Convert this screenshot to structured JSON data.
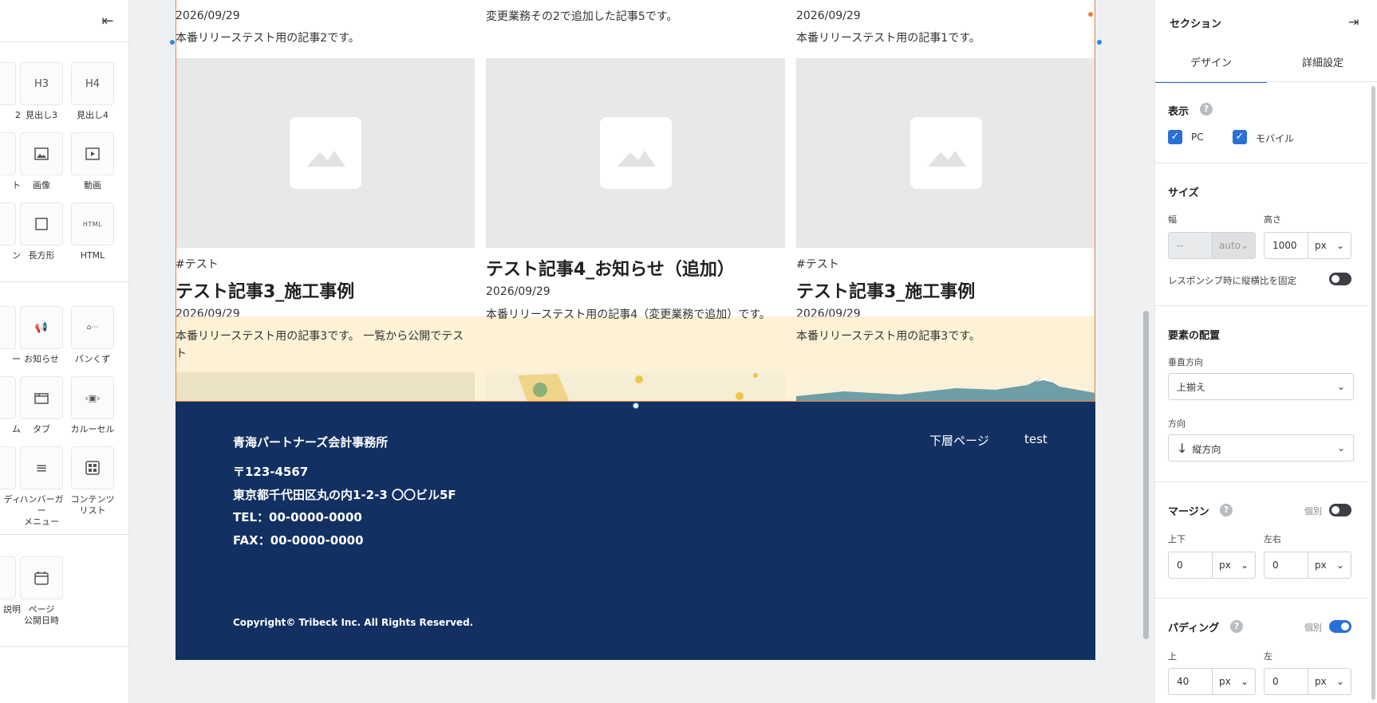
{
  "left_panel": {
    "collapse_icon": "collapse-left-icon",
    "items": [
      {
        "label": "2",
        "icon": "",
        "cut": true
      },
      {
        "label": "見出し3",
        "icon": "H3"
      },
      {
        "label": "見出し4",
        "icon": "H4"
      },
      {
        "label": "ト",
        "icon": "",
        "cut": true
      },
      {
        "label": "画像",
        "icon": "image-icon"
      },
      {
        "label": "動画",
        "icon": "video-icon"
      },
      {
        "label": "ン",
        "icon": "",
        "cut": true
      },
      {
        "label": "長方形",
        "icon": "square-icon"
      },
      {
        "label": "HTML",
        "icon": "HTML"
      },
      {
        "label": "ー",
        "icon": "",
        "cut": true
      },
      {
        "label": "お知らせ",
        "icon": "megaphone-icon"
      },
      {
        "label": "パンくず",
        "icon": "breadcrumb-icon"
      },
      {
        "label": "ム",
        "icon": "",
        "cut": true
      },
      {
        "label": "タブ",
        "icon": "tab-icon"
      },
      {
        "label": "カルーセル",
        "icon": "carousel-icon"
      },
      {
        "label": "ディ",
        "icon": "",
        "cut": true
      },
      {
        "label": "ハンバーガー\nメニュー",
        "icon": "hamburger-icon"
      },
      {
        "label": "コンテンツ\nリスト",
        "icon": "grid-icon"
      },
      {
        "label": "説明",
        "icon": "",
        "cut": true
      },
      {
        "label": "ページ\n公開日時",
        "icon": "calendar-icon"
      }
    ]
  },
  "cards": [
    {
      "date_top": "2026/09/29",
      "desc_top": "本番リリーステスト用の記事2です。",
      "tag": "#テスト",
      "title": "テスト記事3_施工事例",
      "date": "2026/09/29",
      "desc": "本番リリーステスト用の記事3です。 一覧から公開でテスト"
    },
    {
      "date_top": "",
      "desc_top": "変更業務その2で追加した記事5です。",
      "tag": "",
      "title": "テスト記事4_お知らせ（追加）",
      "date": "2026/09/29",
      "desc": "本番リリーステスト用の記事4（変更業務で追加）です。"
    },
    {
      "date_top": "2026/09/29",
      "desc_top": "本番リリーステスト用の記事1です。",
      "tag": "#テスト",
      "title": "テスト記事3_施工事例",
      "date": "2026/09/29",
      "desc": "本番リリーステスト用の記事3です。"
    }
  ],
  "footer": {
    "company": "青海パートナーズ会計事務所",
    "postal": "〒123-4567",
    "address": "東京都千代田区丸の内1-2-3 〇〇ビル5F",
    "tel": "TEL：00-0000-0000",
    "fax": "FAX：00-0000-0000",
    "nav": [
      "下層ページ",
      "test"
    ],
    "copyright": "Copyright© Tribeck Inc. All Rights Reserved."
  },
  "right_panel": {
    "title": "セクション",
    "tabs": [
      "デザイン",
      "詳細設定"
    ],
    "display": {
      "label": "表示",
      "pc": "PC",
      "mobile": "モバイル"
    },
    "size": {
      "label": "サイズ",
      "width_label": "幅",
      "width_value": "--",
      "width_unit": "auto",
      "height_label": "高さ",
      "height_value": "1000",
      "height_unit": "px",
      "responsive": "レスポンシブ時に縦横比を固定"
    },
    "align": {
      "label": "要素の配置",
      "vertical_label": "垂直方向",
      "vertical_value": "上揃え",
      "direction_label": "方向",
      "direction_value": "縦方向"
    },
    "margin": {
      "label": "マージン",
      "individual": "個別",
      "tb_label": "上下",
      "tb_value": "0",
      "lr_label": "左右",
      "lr_value": "0",
      "unit": "px"
    },
    "padding": {
      "label": "パディング",
      "individual": "個別",
      "top_label": "上",
      "top_value": "40",
      "left_label": "左",
      "left_value": "0",
      "unit": "px"
    }
  },
  "colors": {
    "accent": "#2a6fd6",
    "footer_bg": "#123062",
    "selection": "#e8823a",
    "band": "#fdeec8"
  }
}
